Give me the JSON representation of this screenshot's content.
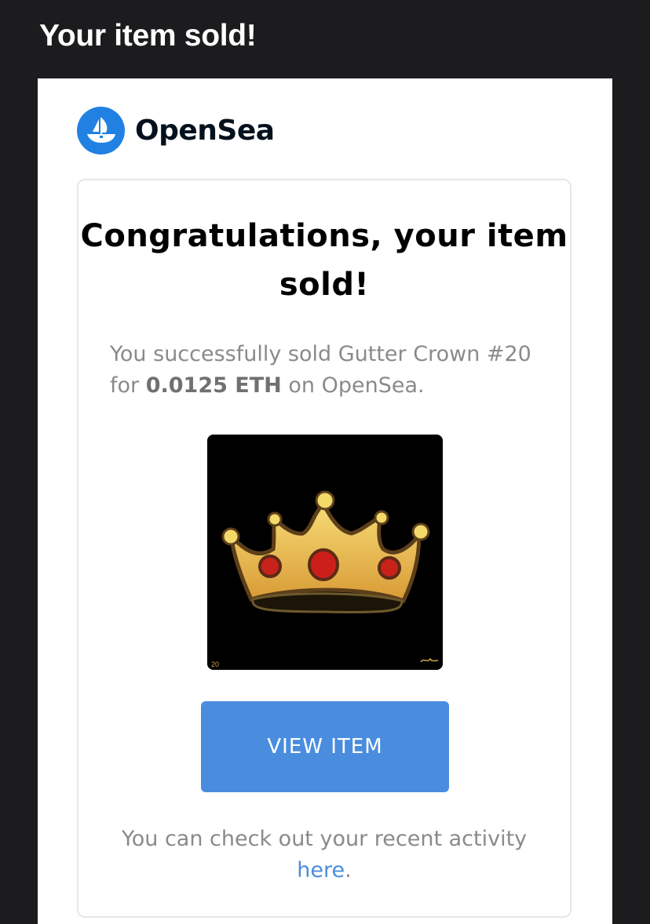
{
  "header": {
    "subject": "Your item sold!"
  },
  "brand": {
    "name": "OpenSea",
    "logo_icon": "opensea-ship-icon",
    "color": "#2081e2"
  },
  "email": {
    "headline": "Congratulations, your item sold!",
    "message_prefix": "You successfully sold Gutter Crown #20 for",
    "price": "0.0125 ETH",
    "message_suffix": "on OpenSea.",
    "item_image": {
      "icon": "crown-icon",
      "corner_label": "20",
      "signature": "Gutter Crown signature"
    },
    "view_button_label": "VIEW ITEM",
    "button_color": "#4a8ddf",
    "footer_text": "You can check out your recent activity",
    "footer_link": "here",
    "footer_end": "."
  }
}
